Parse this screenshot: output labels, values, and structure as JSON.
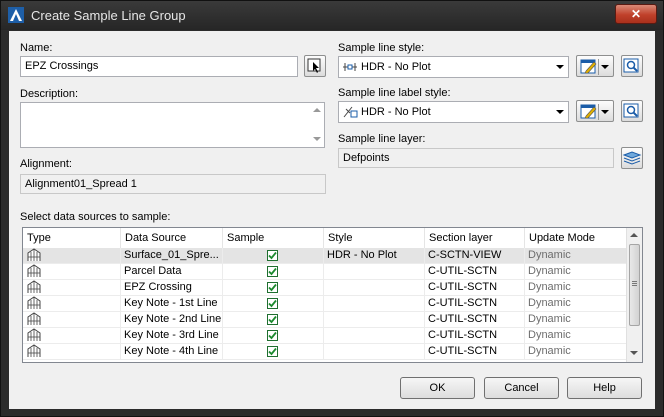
{
  "window": {
    "title": "Create Sample Line Group"
  },
  "name": {
    "label": "Name:",
    "value": "EPZ Crossings"
  },
  "description": {
    "label": "Description:",
    "value": ""
  },
  "alignment": {
    "label": "Alignment:",
    "value": "Alignment01_Spread 1"
  },
  "sample_line_style": {
    "label": "Sample line style:",
    "value": "HDR - No Plot"
  },
  "sample_line_label_style": {
    "label": "Sample line label style:",
    "value": "HDR - No Plot"
  },
  "sample_line_layer": {
    "label": "Sample line layer:",
    "value": "Defpoints"
  },
  "data_sources": {
    "label": "Select data sources to sample:",
    "columns": [
      "Type",
      "Data Source",
      "Sample",
      "Style",
      "Section layer",
      "Update Mode"
    ],
    "rows": [
      {
        "data_source": "Surface_01_Spre...",
        "sample": true,
        "style": "HDR - No Plot",
        "layer": "C-SCTN-VIEW",
        "mode": "Dynamic"
      },
      {
        "data_source": "Parcel Data",
        "sample": true,
        "style": "",
        "layer": "C-UTIL-SCTN",
        "mode": "Dynamic"
      },
      {
        "data_source": "EPZ Crossing",
        "sample": true,
        "style": "",
        "layer": "C-UTIL-SCTN",
        "mode": "Dynamic"
      },
      {
        "data_source": "Key Note - 1st Line",
        "sample": true,
        "style": "",
        "layer": "C-UTIL-SCTN",
        "mode": "Dynamic"
      },
      {
        "data_source": "Key Note - 2nd Line",
        "sample": true,
        "style": "",
        "layer": "C-UTIL-SCTN",
        "mode": "Dynamic"
      },
      {
        "data_source": "Key Note - 3rd Line",
        "sample": true,
        "style": "",
        "layer": "C-UTIL-SCTN",
        "mode": "Dynamic"
      },
      {
        "data_source": "Key Note - 4th Line",
        "sample": true,
        "style": "",
        "layer": "C-UTIL-SCTN",
        "mode": "Dynamic"
      }
    ]
  },
  "buttons": {
    "ok": "OK",
    "cancel": "Cancel",
    "help": "Help"
  }
}
